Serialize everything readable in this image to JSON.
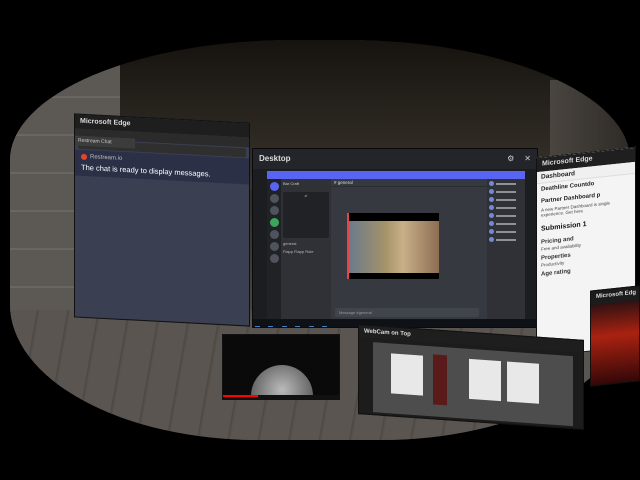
{
  "edge_left": {
    "title": "Microsoft Edge",
    "tab": "Restream Chat",
    "brand": "Restream.io",
    "message": "The chat is ready to display messages."
  },
  "desktop": {
    "title": "Desktop",
    "discord": {
      "server_name": "Bar Craft",
      "channel_name": "general",
      "voice_channel": "Flapp Flapp Rule",
      "chat_placeholder": "Message #general"
    }
  },
  "edge_right": {
    "title": "Microsoft Edge",
    "dashboard": "Dashboard",
    "item": "Deathline Countdo",
    "partner": "Partner Dashboard p",
    "partner_sub": "A new Partner Dashboard is single experience. Get here",
    "submission": "Submission 1",
    "pricing": "Pricing and",
    "pricing_sub": "Free and availability",
    "properties": "Properties",
    "properties_sub": "Productivity",
    "age": "Age rating"
  },
  "edge_mini": {
    "title": "Microsoft Edg"
  },
  "webcam": {
    "title": "WebCam on Top"
  }
}
